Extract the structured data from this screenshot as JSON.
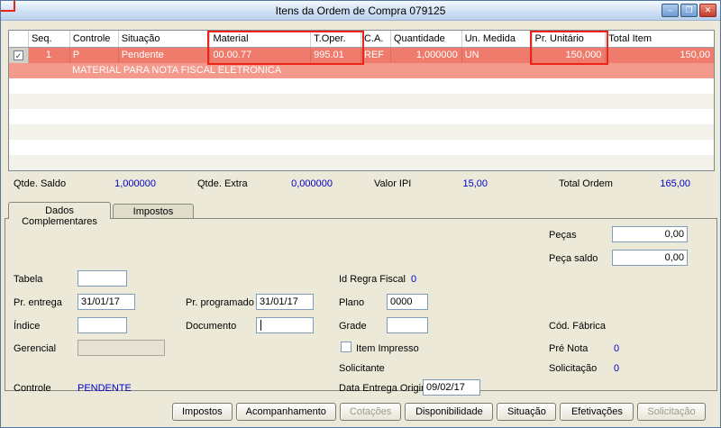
{
  "window": {
    "title": "Itens da Ordem de Compra 079125"
  },
  "icons": {
    "minimize": "–",
    "maximize": "❐",
    "close": "✕",
    "check": "✓"
  },
  "grid": {
    "columns": [
      "",
      "Seq.",
      "Controle",
      "Situação",
      "Material",
      "T.Oper.",
      "C.A.",
      "Quantidade",
      "Un. Medida",
      "Pr. Unitário",
      "Total Item"
    ],
    "row": {
      "seq": "1",
      "controle": "P",
      "situacao": "Pendente",
      "material": "00.00.77",
      "toper": "995.01",
      "ca": "REF",
      "quantidade": "1,000000",
      "un_medida": "UN",
      "pr_unitario": "150,000",
      "total_item": "150,00",
      "checked": true
    },
    "description": "MATERIAL PARA NOTA FISCAL ELETRONICA"
  },
  "summary": {
    "qtde_saldo_label": "Qtde. Saldo",
    "qtde_saldo": "1,000000",
    "qtde_extra_label": "Qtde. Extra",
    "qtde_extra": "0,000000",
    "valor_ipi_label": "Valor IPI",
    "valor_ipi": "15,00",
    "total_ordem_label": "Total Ordem",
    "total_ordem": "165,00"
  },
  "tabs": [
    {
      "label": "Dados Complementares",
      "active": true
    },
    {
      "label": "Impostos",
      "active": false
    }
  ],
  "form": {
    "pecas_label": "Peças",
    "pecas": "0,00",
    "peca_saldo_label": "Peça saldo",
    "peca_saldo": "0,00",
    "tabela_label": "Tabela",
    "tabela": "",
    "pr_entrega_label": "Pr. entrega",
    "pr_entrega": "31/01/17",
    "pr_programado_label": "Pr. programado",
    "pr_programado": "31/01/17",
    "indice_label": "Índice",
    "indice": "",
    "documento_label": "Documento",
    "documento": "",
    "gerencial_label": "Gerencial",
    "gerencial": "",
    "controle_label": "Controle",
    "controle_value": "PENDENTE",
    "id_regra_fiscal_label": "Id Regra Fiscal",
    "id_regra_fiscal": "0",
    "plano_label": "Plano",
    "plano": "0000",
    "grade_label": "Grade",
    "grade": "",
    "item_impresso_label": "Item Impresso",
    "item_impresso_checked": false,
    "solicitante_label": "Solicitante",
    "data_entrega_original_label": "Data Entrega Original",
    "data_entrega_original": "09/02/17",
    "cod_fabrica_label": "Cód. Fábrica",
    "pre_nota_label": "Pré Nota",
    "pre_nota": "0",
    "solicitacao_label": "Solicitação",
    "solicitacao": "0"
  },
  "footer": {
    "buttons": [
      {
        "label": "Impostos",
        "enabled": true
      },
      {
        "label": "Acompanhamento",
        "enabled": true
      },
      {
        "label": "Cotações",
        "enabled": false
      },
      {
        "label": "Disponibilidade",
        "enabled": true
      },
      {
        "label": "Situação",
        "enabled": true
      },
      {
        "label": "Efetivações",
        "enabled": true
      },
      {
        "label": "Solicitação",
        "enabled": false
      }
    ]
  },
  "colors": {
    "selected_row": "#EF7B6C",
    "selected_row_description": "#F49A8C",
    "value_blue": "#0000C8",
    "annotation_red": "#EE2318",
    "titlebar_blue": "#BBD1EB",
    "window_face": "#ECE9D8"
  }
}
